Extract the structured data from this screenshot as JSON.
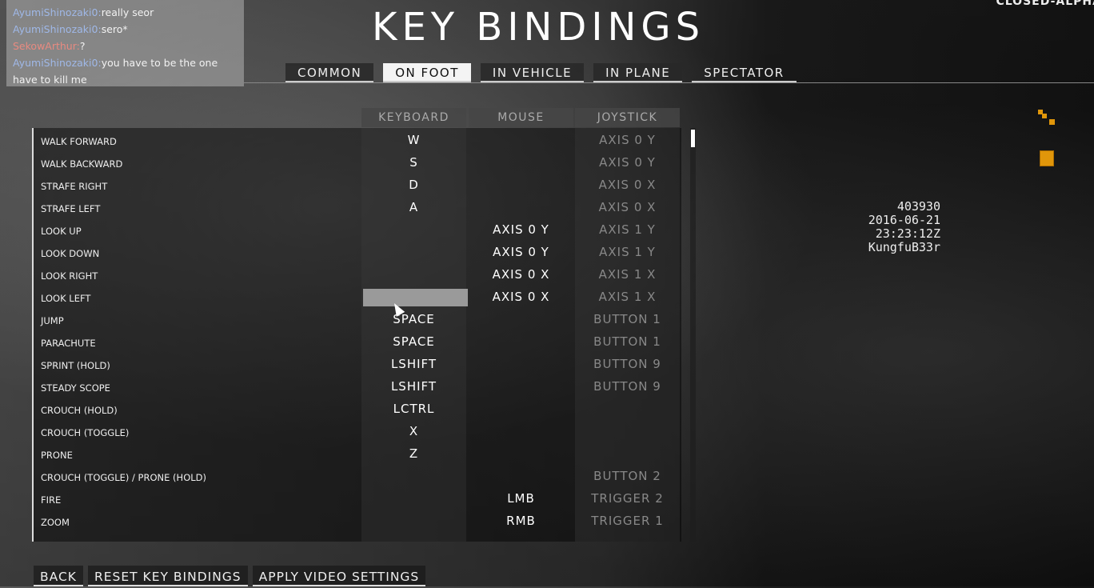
{
  "title": "KEY BINDINGS",
  "build_label": "CLOSED-ALPHA",
  "chat": [
    {
      "user": "AyumiShinozaki0",
      "message": "really seor",
      "user_color": "#9fb8e8"
    },
    {
      "user": "AyumiShinozaki0",
      "message": "sero*",
      "user_color": "#9fb8e8"
    },
    {
      "user": "SekowArthur",
      "message": "?",
      "user_color": "#e88a80"
    },
    {
      "user": "AyumiShinozaki0",
      "message": "you have to be the one have to kill me",
      "user_color": "#9fb8e8"
    }
  ],
  "tabs": [
    {
      "label": "COMMON"
    },
    {
      "label": "ON FOOT",
      "active": true
    },
    {
      "label": "IN VEHICLE"
    },
    {
      "label": "IN PLANE"
    },
    {
      "label": "SPECTATOR"
    }
  ],
  "columns": {
    "keyboard": "KEYBOARD",
    "mouse": "MOUSE",
    "joystick": "JOYSTICK"
  },
  "rows": [
    {
      "action": "WALK FORWARD",
      "keyboard": "W",
      "mouse": "",
      "joystick": "AXIS 0 Y"
    },
    {
      "action": "WALK BACKWARD",
      "keyboard": "S",
      "mouse": "",
      "joystick": "AXIS 0 Y"
    },
    {
      "action": "STRAFE RIGHT",
      "keyboard": "D",
      "mouse": "",
      "joystick": "AXIS 0 X"
    },
    {
      "action": "STRAFE LEFT",
      "keyboard": "A",
      "mouse": "",
      "joystick": "AXIS 0 X"
    },
    {
      "action": "LOOK UP",
      "keyboard": "",
      "mouse": "AXIS 0 Y",
      "joystick": "AXIS 1 Y"
    },
    {
      "action": "LOOK DOWN",
      "keyboard": "",
      "mouse": "AXIS 0 Y",
      "joystick": "AXIS 1 Y"
    },
    {
      "action": "LOOK RIGHT",
      "keyboard": "",
      "mouse": "AXIS 0 X",
      "joystick": "AXIS 1 X"
    },
    {
      "action": "LOOK LEFT",
      "keyboard": "",
      "mouse": "AXIS 0 X",
      "joystick": "AXIS 1 X"
    },
    {
      "action": "JUMP",
      "keyboard": "SPACE",
      "mouse": "",
      "joystick": "BUTTON 1"
    },
    {
      "action": "PARACHUTE",
      "keyboard": "SPACE",
      "mouse": "",
      "joystick": "BUTTON 1"
    },
    {
      "action": "SPRINT (HOLD)",
      "keyboard": "LSHIFT",
      "mouse": "",
      "joystick": "BUTTON 9"
    },
    {
      "action": "STEADY SCOPE",
      "keyboard": "LSHIFT",
      "mouse": "",
      "joystick": "BUTTON 9"
    },
    {
      "action": "CROUCH (HOLD)",
      "keyboard": "LCTRL",
      "mouse": "",
      "joystick": ""
    },
    {
      "action": "CROUCH (TOGGLE)",
      "keyboard": "X",
      "mouse": "",
      "joystick": ""
    },
    {
      "action": "PRONE",
      "keyboard": "Z",
      "mouse": "",
      "joystick": ""
    },
    {
      "action": "CROUCH (TOGGLE) / PRONE (HOLD)",
      "keyboard": "",
      "mouse": "",
      "joystick": "BUTTON 2"
    },
    {
      "action": "FIRE",
      "keyboard": "",
      "mouse": "LMB",
      "joystick": "TRIGGER 2"
    },
    {
      "action": "ZOOM",
      "keyboard": "",
      "mouse": "RMB",
      "joystick": "TRIGGER 1"
    }
  ],
  "buttons": {
    "back": "BACK",
    "reset": "RESET KEY BINDINGS",
    "apply": "APPLY VIDEO SETTINGS"
  },
  "info": {
    "id": "403930",
    "date": "2016-06-21",
    "time": "23:23:12Z",
    "player": "KungfuB33r"
  },
  "icons": {
    "squad": "squad-icon",
    "objective": "objective-icon",
    "accent": "#e0960a"
  }
}
